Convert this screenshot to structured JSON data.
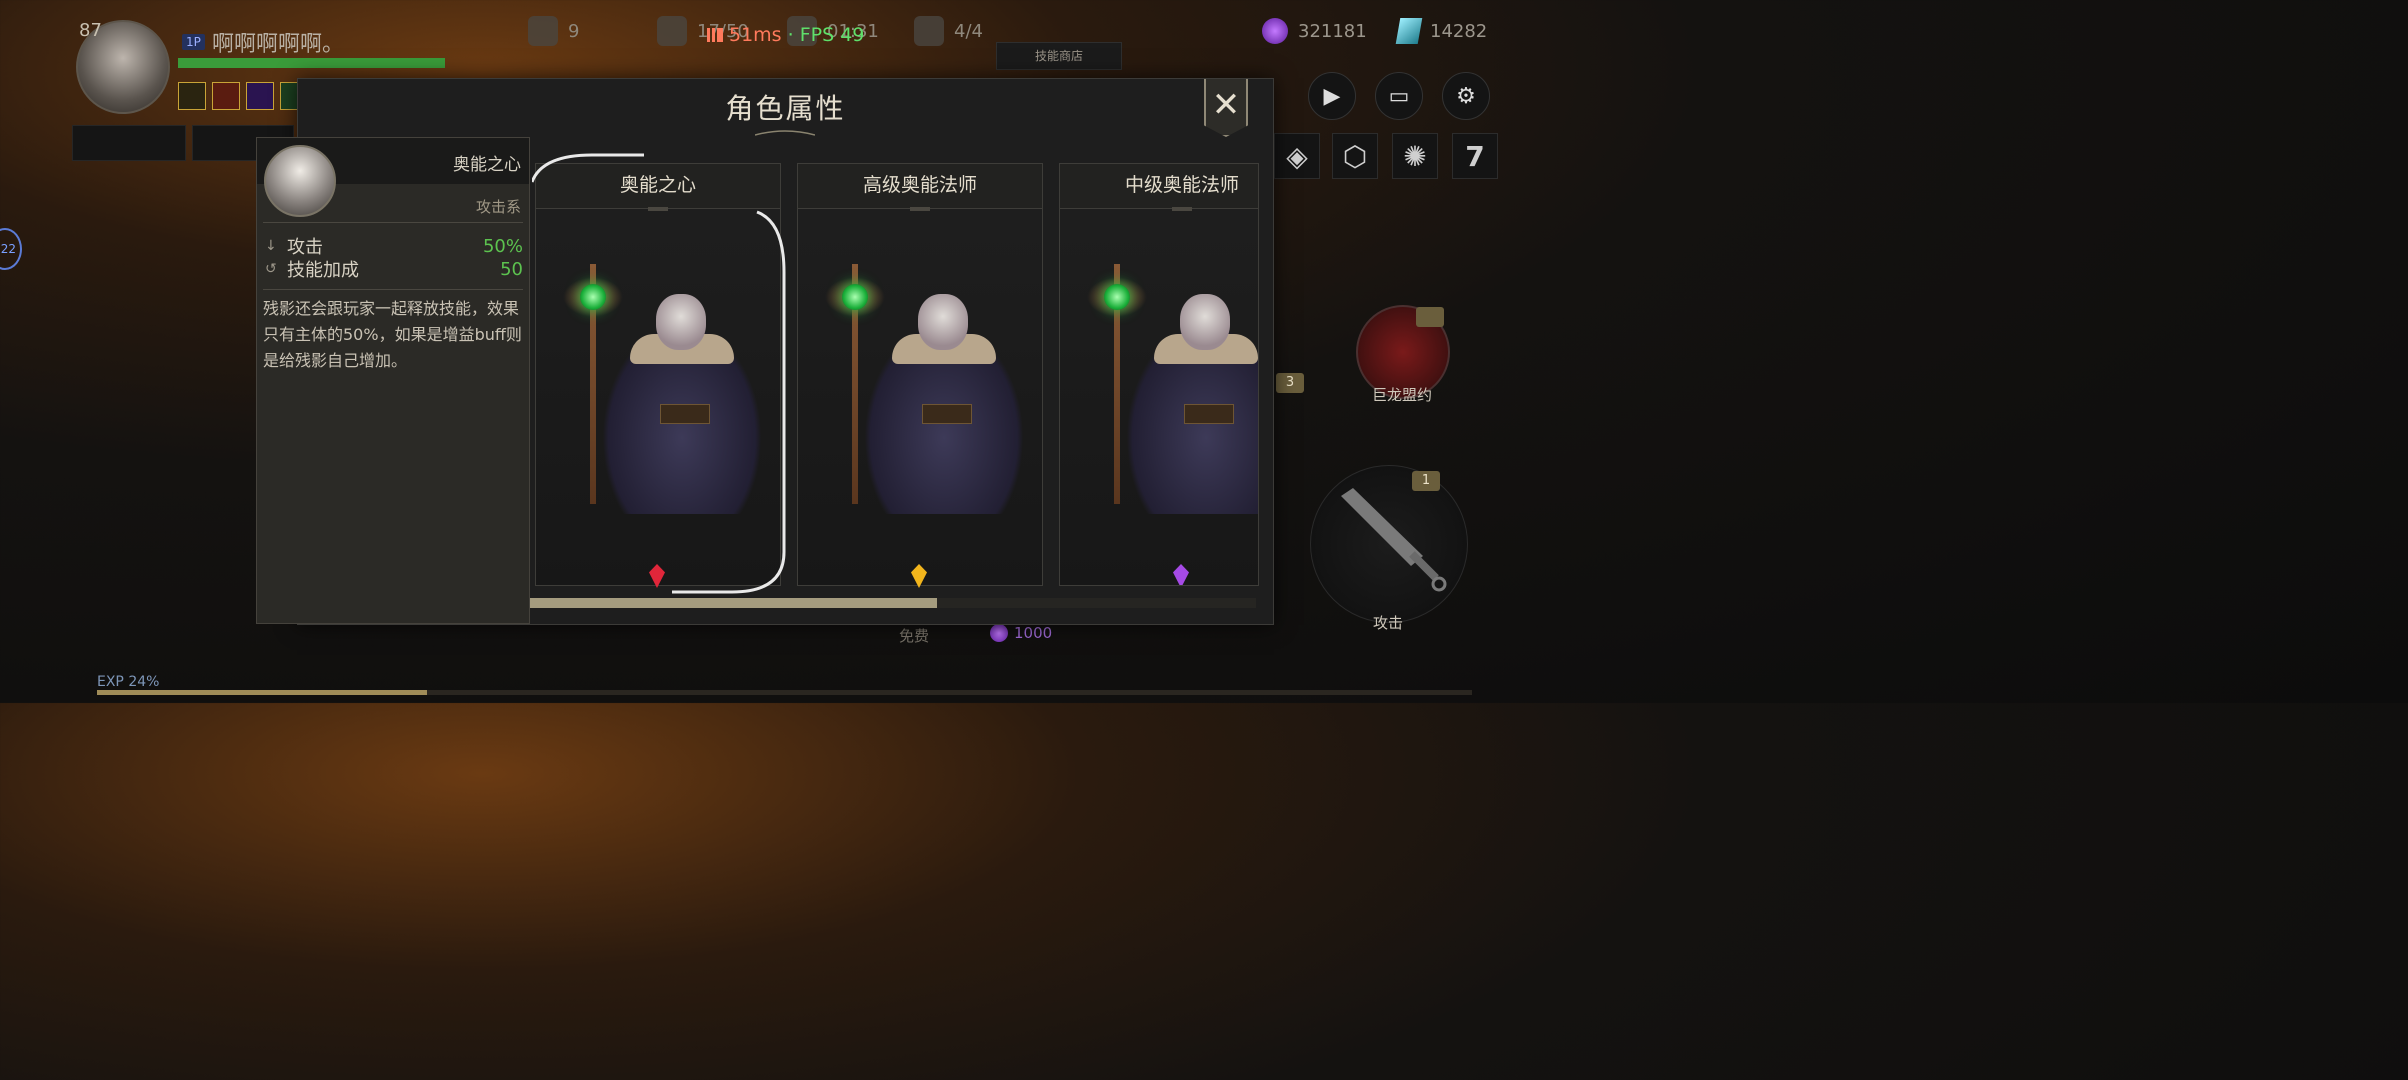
{
  "player": {
    "level": "87",
    "badge": "1P",
    "name": "啊啊啊啊啊。",
    "hp_fraction": 1.0
  },
  "hud_stats": [
    {
      "icon": "fist-icon",
      "value": "9"
    },
    {
      "icon": "heart-icon",
      "value": "17/50"
    },
    {
      "icon": "wolf-icon",
      "value": "01:31"
    },
    {
      "icon": "demon-mask-icon",
      "value": "4/4"
    }
  ],
  "network": {
    "ping": "51ms",
    "separator": " · ",
    "fps": "FPS 49"
  },
  "shop_button": "技能商店",
  "currency": {
    "purple_gems": "321181",
    "teal_crystals": "14282"
  },
  "left_bubble": "22",
  "modal": {
    "title": "角色属性",
    "close": "✕",
    "info": {
      "name": "奥能之心",
      "type": "攻击系",
      "stats": [
        {
          "icon": "sword-icon",
          "label": "攻击",
          "value": "50%"
        },
        {
          "icon": "swirl-icon",
          "label": "技能加成",
          "value": "50"
        }
      ],
      "description": "残影还会跟玩家一起释放技能，效果只有主体的50%，如果是增益buff则是给残影自己增加。"
    },
    "cards": [
      {
        "title": "奥能之心",
        "gem_color": "#e0263a"
      },
      {
        "title": "高级奥能法师",
        "gem_color": "#f2b51c"
      },
      {
        "title": "中级奥能法师",
        "gem_color": "#a64ae6"
      }
    ],
    "scroll_fraction": 0.56
  },
  "below_modal": {
    "free": "免费",
    "cost": "1000"
  },
  "right_panel": {
    "dragon_label": "巨龙盟约",
    "side_badge": "3",
    "attack_badge": "1",
    "attack_label": "攻击",
    "square_last": "7"
  },
  "exp": {
    "label": "EXP 24%",
    "fraction": 0.24
  }
}
